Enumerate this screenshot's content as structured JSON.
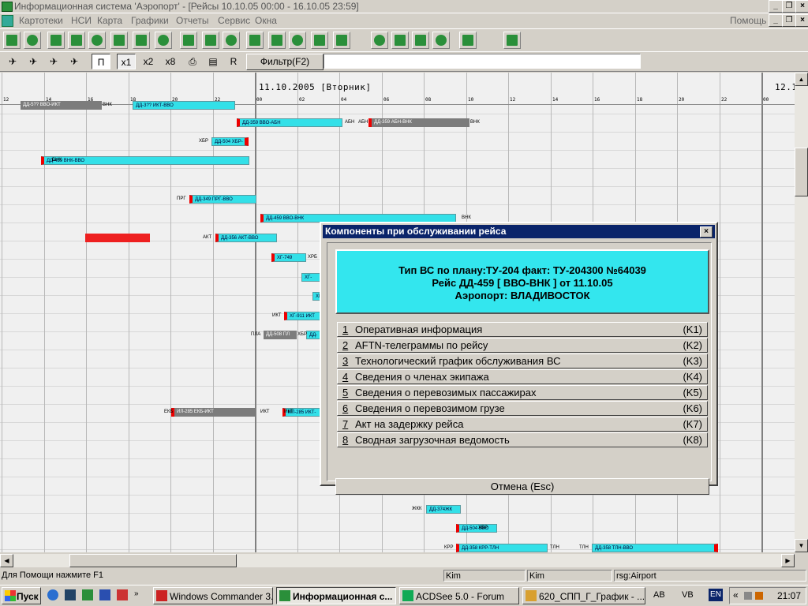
{
  "window": {
    "title": "Информационная система 'Аэропорт' - [Рейсы 10.10.05 00:00 - 16.10.05 23:59]",
    "help_label": "Помощь"
  },
  "menu": [
    "Картотеки",
    "НСИ",
    "Карта",
    "Графики",
    "Отчеты",
    "Сервис",
    "Окна"
  ],
  "toolbar2": {
    "zoom": [
      "x1",
      "x2",
      "x8"
    ],
    "p_label": "П",
    "r_label": "R",
    "filter_label": "Фильтр(F2)",
    "filter_value": ""
  },
  "toolbar1_icons": [
    "spo-icon",
    "tv-icon",
    "chart-icon",
    "map-icon",
    "globe-icon",
    "plane-icon",
    "factory-icon",
    "gear-icon",
    "tree-icon",
    "board-icon",
    "grid-icon",
    "calendar-icon",
    "tools-icon",
    "doc-icon",
    "list-icon",
    "save-icon",
    "dot-icon",
    "group-icon",
    "print-icon",
    "chart2-icon",
    "list2-icon",
    "new-icon"
  ],
  "gantt": {
    "day_headers": [
      {
        "text": "11.10.2005  [Вторник]"
      },
      {
        "text": "12.1"
      }
    ],
    "ticks": [
      "12",
      "14",
      "16",
      "18",
      "20",
      "22",
      "00",
      "02",
      "04",
      "06",
      "08",
      "10",
      "12",
      "14",
      "16",
      "18",
      "20",
      "22",
      "00",
      "02"
    ],
    "bars": [
      {
        "label": "ДД-5?? ВВО-ИКТ",
        "color": "gray"
      },
      {
        "label": "ДД-3?? ИКТ-ВВО",
        "color": "cyan"
      },
      {
        "label": "ДД-359 ВВО-АБН",
        "color": "cyan"
      },
      {
        "label": "ДД-359 АБН-ВНК",
        "color": "gray"
      },
      {
        "label": "ДД-504 ХБР-",
        "color": "cyan"
      },
      {
        "label": "ДД-459 ВНК-ВВО",
        "color": "cyan"
      },
      {
        "label": "ДД-349 ПРГ-ВВО",
        "color": "cyan"
      },
      {
        "label": "ДД-459 ВВО-ВНК",
        "color": "cyan"
      },
      {
        "label": "",
        "color": "red"
      },
      {
        "label": "ДД-356 АКТ-ВВО",
        "color": "cyan"
      },
      {
        "label": "ХГ-749",
        "color": "cyan"
      },
      {
        "label": "ХГ-",
        "color": "cyan"
      },
      {
        "label": "ХГ-",
        "color": "cyan"
      },
      {
        "label": "ХГ-911 ИКТ",
        "color": "cyan"
      },
      {
        "label": "ДД-508 ПЛ",
        "color": "gray"
      },
      {
        "label": "ДД-",
        "color": "cyan"
      },
      {
        "label": "ИЛ-285 ЕКБ-ИКТ",
        "color": "gray"
      },
      {
        "label": "ИЛ-285 ИКТ-",
        "color": "cyan"
      },
      {
        "label": "ЖЛК-4418",
        "color": "gray"
      },
      {
        "label": "ДД-374ЖК",
        "color": "cyan"
      },
      {
        "label": "ДД-504 ВВО",
        "color": "cyan"
      },
      {
        "label": "ДД-358 КРР-ТЛН",
        "color": "cyan"
      },
      {
        "label": "ДД-358 ТЛН-ВВО",
        "color": "cyan"
      }
    ],
    "airport_labels": [
      "ВНК",
      "АБН",
      "АБН",
      "ВНК",
      "ХБР",
      "ВНК",
      "ПРГ",
      "ВНК",
      "АКТ",
      "ХРБ",
      "ИКТ",
      "ПЛА",
      "ХБР",
      "ЕКБ",
      "ИКТ",
      "ИКТ",
      "ЖКК",
      "ХБР",
      "КРР",
      "ТЛН",
      "ТЛН"
    ]
  },
  "dialog": {
    "title": "Компоненты при обслуживании рейса",
    "close_label": "×",
    "info_lines": [
      "Тип ВС по плану:ТУ-204  факт: ТУ-204300 №64039",
      "Рейс ДД-459 [ ВВО-ВНК ] от 11.10.05",
      "Аэропорт: ВЛАДИВОСТОК"
    ],
    "items": [
      {
        "num": "1",
        "label": "Оперативная информация",
        "key": "(K1)"
      },
      {
        "num": "2",
        "label": "AFTN-телеграммы по рейсу",
        "key": "(K2)"
      },
      {
        "num": "3",
        "label": "Технологический график обслуживания ВС",
        "key": "(K3)"
      },
      {
        "num": "4",
        "label": "Сведения о членах экипажа",
        "key": "(K4)"
      },
      {
        "num": "5",
        "label": "Сведения о перевозимых пассажирах",
        "key": "(K5)"
      },
      {
        "num": "6",
        "label": "Сведения о перевозимом грузе",
        "key": "(K6)"
      },
      {
        "num": "7",
        "label": "Акт на задержку рейса",
        "key": "(K7)"
      },
      {
        "num": "8",
        "label": "Сводная загрузочная ведомость",
        "key": "(K8)"
      }
    ],
    "cancel_label": "Отмена (Esc)"
  },
  "statusbar": {
    "help": "Для Помощи нажмите F1",
    "user1": "Kim",
    "user2": "Kim",
    "server": "rsg:Airport"
  },
  "taskbar": {
    "start_label": "Пуск",
    "tasks": [
      {
        "label": "Windows Commander 3..."
      },
      {
        "label": "Информационная с..."
      },
      {
        "label": "ACDSee 5.0 - Forum"
      },
      {
        "label": "620_СПП_Г_График - ..."
      }
    ],
    "tray": {
      "ab": "AB",
      "vb": "VB",
      "lang": "EN",
      "time": "21:07"
    }
  }
}
